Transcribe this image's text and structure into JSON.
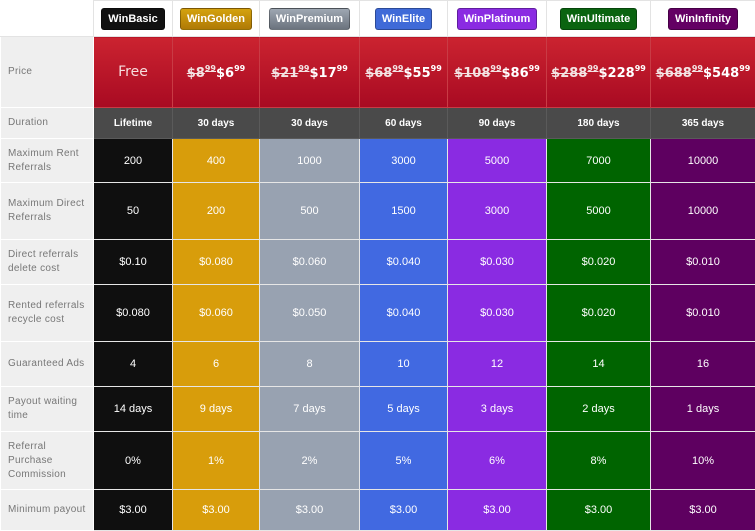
{
  "plans": [
    {
      "name": "WinBasic",
      "color": "#0f0f0f",
      "price_free": "Free",
      "duration": "Lifetime"
    },
    {
      "name": "WinGolden",
      "color": "#d89d0b",
      "old_price": "$8",
      "old_cents": "99",
      "new_price": "$6",
      "new_cents": "99",
      "duration": "30 days"
    },
    {
      "name": "WinPremium",
      "color": "#98a2b1",
      "old_price": "$21",
      "old_cents": "99",
      "new_price": "$17",
      "new_cents": "99",
      "duration": "30 days"
    },
    {
      "name": "WinElite",
      "color": "#4169e1",
      "old_price": "$68",
      "old_cents": "99",
      "new_price": "$55",
      "new_cents": "99",
      "duration": "60 days"
    },
    {
      "name": "WinPlatinum",
      "color": "#8a2be2",
      "old_price": "$108",
      "old_cents": "99",
      "new_price": "$86",
      "new_cents": "99",
      "duration": "90 days"
    },
    {
      "name": "WinUltimate",
      "color": "#006400",
      "old_price": "$288",
      "old_cents": "99",
      "new_price": "$228",
      "new_cents": "99",
      "duration": "180 days"
    },
    {
      "name": "WinInfinity",
      "color": "#5e0060",
      "old_price": "$688",
      "old_cents": "99",
      "new_price": "$548",
      "new_cents": "99",
      "duration": "365 days"
    }
  ],
  "labels": {
    "price": "Price",
    "duration": "Duration"
  },
  "rows": [
    {
      "label": "Maximum Rent Referrals",
      "values": [
        "200",
        "400",
        "1000",
        "3000",
        "5000",
        "7000",
        "10000"
      ]
    },
    {
      "label": "Maximum Direct Referrals",
      "values": [
        "50",
        "200",
        "500",
        "1500",
        "3000",
        "5000",
        "10000"
      ]
    },
    {
      "label": "Direct referrals delete cost",
      "values": [
        "$0.10",
        "$0.080",
        "$0.060",
        "$0.040",
        "$0.030",
        "$0.020",
        "$0.010"
      ]
    },
    {
      "label": "Rented referrals recycle cost",
      "values": [
        "$0.080",
        "$0.060",
        "$0.050",
        "$0.040",
        "$0.030",
        "$0.020",
        "$0.010"
      ]
    },
    {
      "label": "Guaranteed Ads",
      "values": [
        "4",
        "6",
        "8",
        "10",
        "12",
        "14",
        "16"
      ]
    },
    {
      "label": "Payout waiting time",
      "values": [
        "14 days",
        "9 days",
        "7 days",
        "5 days",
        "3 days",
        "2 days",
        "1 days"
      ]
    },
    {
      "label": "Referral Purchase Commission",
      "values": [
        "0%",
        "1%",
        "2%",
        "5%",
        "6%",
        "8%",
        "10%"
      ]
    },
    {
      "label": "Minimum payout",
      "values": [
        "$3.00",
        "$3.00",
        "$3.00",
        "$3.00",
        "$3.00",
        "$3.00",
        "$3.00"
      ]
    }
  ]
}
